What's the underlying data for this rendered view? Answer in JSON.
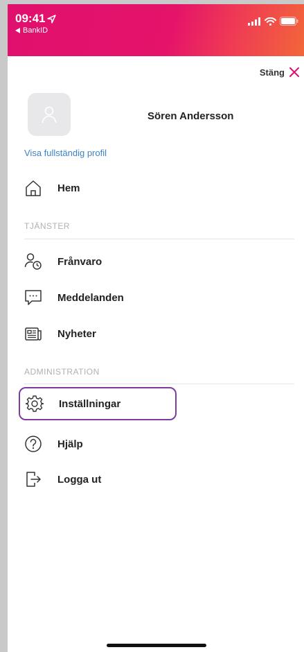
{
  "status_bar": {
    "time": "09:41",
    "back_app": "BankID"
  },
  "header": {
    "close_label": "Stäng"
  },
  "profile": {
    "name": "Sören Andersson",
    "link": "Visa fullständig profil"
  },
  "menu": {
    "home": "Hem",
    "services_heading": "TJÄNSTER",
    "services": [
      "Frånvaro",
      "Meddelanden",
      "Nyheter"
    ],
    "admin_heading": "ADMINISTRATION",
    "admin": [
      "Inställningar",
      "Hjälp",
      "Logga ut"
    ]
  },
  "colors": {
    "brand": "#e5136a",
    "accent": "#e0106e",
    "link": "#3c82c3",
    "selection": "#7d3a9f"
  }
}
